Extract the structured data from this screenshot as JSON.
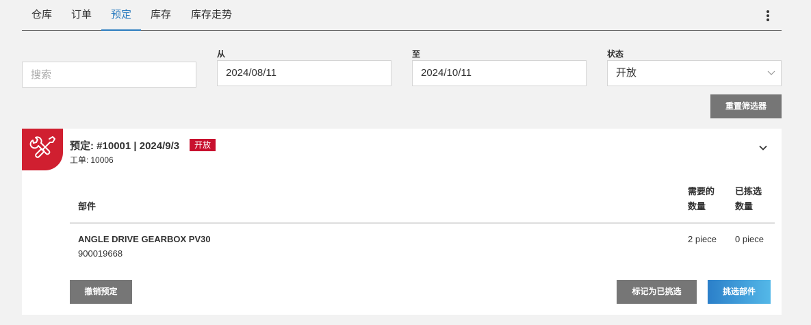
{
  "tabs": [
    {
      "label": "仓库"
    },
    {
      "label": "订单"
    },
    {
      "label": "预定"
    },
    {
      "label": "库存"
    },
    {
      "label": "库存走势"
    }
  ],
  "active_tab": "预定",
  "filters": {
    "search_placeholder": "搜索",
    "from_label": "从",
    "from_value": "2024/08/11",
    "to_label": "至",
    "to_value": "2024/10/11",
    "status_label": "状态",
    "status_value": "开放",
    "reset_label": "重置筛选器"
  },
  "reservation": {
    "title": "预定: #10001 | 2024/9/3",
    "status": "开放",
    "work_order_label": "工单:",
    "work_order_value": "10006",
    "columns": {
      "part": "部件",
      "required_l1": "需要的",
      "required_l2": "数量",
      "picked_l1": "已拣选",
      "picked_l2": "数量"
    },
    "items": [
      {
        "name": "ANGLE DRIVE GEARBOX PV30",
        "number": "900019668",
        "required": "2 piece",
        "picked": "0 piece"
      }
    ],
    "actions": {
      "cancel": "撤销预定",
      "mark_picked": "标记为已挑选",
      "pick_parts": "挑选部件"
    }
  },
  "colors": {
    "accent": "#2a7bbf",
    "brand_red": "#d01f30",
    "button_gray": "#767676"
  },
  "icons": {
    "kebab": "more-vertical-icon",
    "card": "tools-icon",
    "status_select": "chevron-down-icon",
    "expand": "chevron-down-icon"
  }
}
